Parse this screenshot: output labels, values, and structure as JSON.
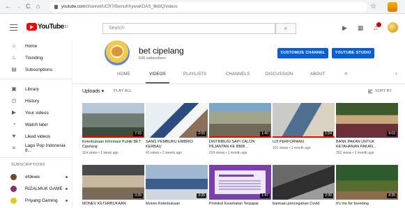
{
  "browser": {
    "back": "←",
    "forward": "→",
    "reload": "C",
    "home": "⌂",
    "url_host": "youtube.com",
    "url_path": "/channel/UCR7rBxmuKKywwKDAS_9kbIQ/videos",
    "star": "☆"
  },
  "masthead": {
    "logo_text": "YouTube",
    "logo_sup": "ID",
    "search_placeholder": "Search",
    "search_icon": "search-icon"
  },
  "sidebar": {
    "main": [
      {
        "label": "Home",
        "icon": "home-icon",
        "glyph": "⌂"
      },
      {
        "label": "Trending",
        "icon": "flame-icon",
        "glyph": "♨"
      },
      {
        "label": "Subscriptions",
        "icon": "subscriptions-icon",
        "glyph": "▤"
      }
    ],
    "library": [
      {
        "label": "Library",
        "icon": "library-icon",
        "glyph": "▣"
      },
      {
        "label": "History",
        "icon": "history-icon",
        "glyph": "◷"
      },
      {
        "label": "Your videos",
        "icon": "your-videos-icon",
        "glyph": "▶"
      },
      {
        "label": "Watch later",
        "icon": "watch-later-icon",
        "glyph": "◔"
      },
      {
        "label": "Liked videos",
        "icon": "thumbs-up-icon",
        "glyph": "♥"
      },
      {
        "label": "Lagu Pop Indonesia 9...",
        "icon": "playlist-icon",
        "glyph": "≡"
      }
    ],
    "subscriptions_heading": "SUBSCRIPTIONS",
    "subscriptions": [
      {
        "label": "efdewe",
        "color": "#6b4a2b"
      },
      {
        "label": "RIZALMUK GAME",
        "color": "#8a2d6b"
      },
      {
        "label": "Priyang Gaming",
        "color": "#e9c81d"
      }
    ]
  },
  "channel": {
    "name": "bet cipelang",
    "subscribers": "636 subscribers",
    "customize_label": "CUSTOMIZE CHANNEL",
    "studio_label": "YOUTUBE STUDIO"
  },
  "tabs": [
    {
      "label": "HOME",
      "active": false
    },
    {
      "label": "VIDEOS",
      "active": true
    },
    {
      "label": "PLAYLISTS",
      "active": false
    },
    {
      "label": "CHANNELS",
      "active": false
    },
    {
      "label": "DISCUSSION",
      "active": false
    },
    {
      "label": "ABOUT",
      "active": false
    }
  ],
  "uploads": {
    "label": "Uploads ▾",
    "play_all": "PLAY ALL",
    "sort_by": "SORT BY"
  },
  "videos": [
    {
      "title": "Keterbukaan Informasi Publik BET Cipelang",
      "meta": "114 views • 1 week ago",
      "duration": "7:33",
      "progress": 1.0
    },
    {
      "title": "SANG PEMBURU EMBRIO KERBAU",
      "meta": "43 views • 2 weeks ago",
      "duration": "2:05",
      "progress": 0.0
    },
    {
      "title": "DISTRIBUSI SAPI CALON PEJANTAN KE BBIB...",
      "meta": "224 views • 1 month ago",
      "duration": "1:40",
      "progress": 1.0
    },
    {
      "title": "UJI PERFORMAN",
      "meta": "101 views • 1 month ago",
      "duration": "1:54",
      "progress": 1.0
    },
    {
      "title": "BANK PAKAN UNTUK KETAHANAN PAKAN...",
      "meta": "352 views • 1 month ago",
      "duration": "4:03",
      "progress": 0.0
    },
    {
      "title": "MONEV KETERBUKAAN",
      "meta": "",
      "duration": "3:35",
      "progress": 0.0
    },
    {
      "title": "Monev Keterbukaan",
      "meta": "",
      "duration": "3:35",
      "progress": 0.0
    },
    {
      "title": "Protokol Kesehatan Terpapar",
      "meta": "",
      "duration": "1:47",
      "progress": 0.0
    },
    {
      "title": "bantuan pencegahan Covid",
      "meta": "",
      "duration": "2:30",
      "progress": 0.0
    },
    {
      "title": "It's me for breeding",
      "meta": "",
      "duration": "4:35",
      "progress": 0.0
    }
  ]
}
